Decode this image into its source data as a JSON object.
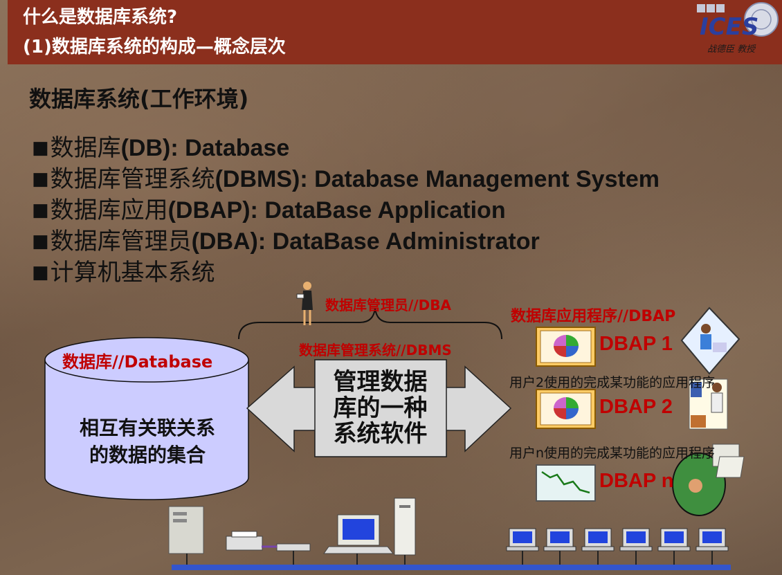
{
  "header": {
    "title_line1": "什么是数据库系统?",
    "title_line2": "(1)数据库系统的构成—概念层次",
    "logo_text": "ICES",
    "logo_caption": "战德臣 教授"
  },
  "section_title": "数据库系统(工作环境)",
  "bullets": [
    {
      "cn": "数据库",
      "en": "(DB): Database"
    },
    {
      "cn": "数据库管理系统",
      "en": "(DBMS): Database Management System"
    },
    {
      "cn": "数据库应用",
      "en": "(DBAP): DataBase Application"
    },
    {
      "cn": "数据库管理员",
      "en": "(DBA): DataBase Administrator"
    },
    {
      "cn": "计算机基本系统",
      "en": ""
    }
  ],
  "bullet_mark": "■",
  "diagram": {
    "dba_label": "数据库管理员//DBA",
    "dbms_label": "数据库管理系统//DBMS",
    "dbap_label": "数据库应用程序//DBAP",
    "db_label": "数据库//Database",
    "cylinder_text_line1": "相互有关联关系",
    "cylinder_text_line2": "的数据的集合",
    "arrow_text_line1": "管理数据",
    "arrow_text_line2": "库的一种",
    "arrow_text_line3": "系统软件",
    "dbap1": "DBAP 1",
    "dbap2": "DBAP 2",
    "dbapn": "DBAP n",
    "user2_text": "用户2使用的完成某功能的应用程序",
    "usern_text": "用户n使用的完成某功能的应用程序"
  },
  "colors": {
    "header_bg": "#8b2f1d",
    "label_red": "#c00000",
    "cylinder_fill": "#ccccff",
    "arrow_fill": "#d9d9d9",
    "network_line": "#3355cc"
  }
}
